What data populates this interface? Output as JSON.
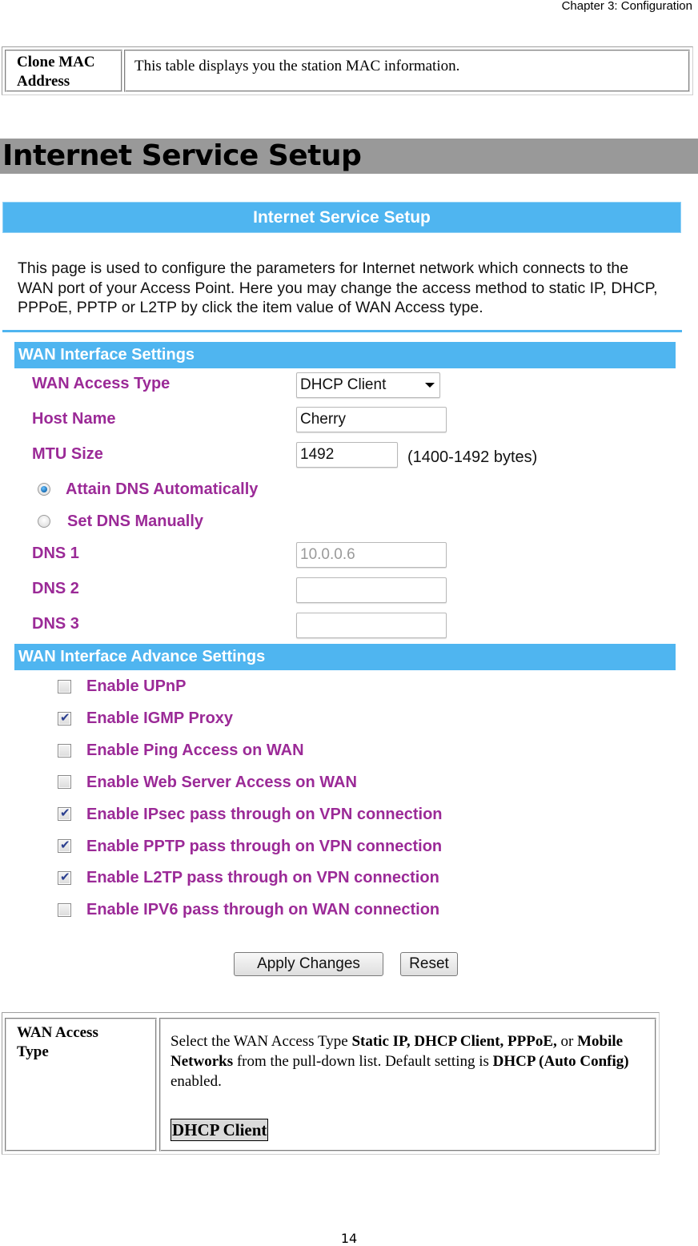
{
  "header": {
    "chapter": "Chapter 3: Configuration"
  },
  "clone_mac_table": {
    "label": "Clone MAC Address",
    "label_line1": "Clone MAC",
    "label_line2": "Address",
    "description": "This table displays you the station MAC information."
  },
  "section": {
    "title": "Internet Service Setup"
  },
  "ui": {
    "title": "Internet Service Setup",
    "intro": "This page is used to configure the parameters for Internet network which connects to the WAN port of your Access Point. Here you may change the access method to static IP, DHCP, PPPoE, PPTP or L2TP by click the item value of WAN Access type.",
    "colors": {
      "bar": "#4fb5f0",
      "label": "#9b2a97"
    },
    "wan_settings": {
      "heading": "WAN Interface Settings",
      "wan_access_type": {
        "label": "WAN Access Type",
        "selected": "DHCP Client"
      },
      "host_name": {
        "label": "Host Name",
        "value": "Cherry"
      },
      "mtu_size": {
        "label": "MTU Size",
        "value": "1492",
        "hint": "(1400-1492 bytes)"
      },
      "dns_mode": [
        {
          "label": "Attain DNS Automatically",
          "checked": true
        },
        {
          "label": "Set DNS Manually",
          "checked": false
        }
      ],
      "dns1": {
        "label": "DNS 1",
        "value": "10.0.0.6"
      },
      "dns2": {
        "label": "DNS 2",
        "value": ""
      },
      "dns3": {
        "label": "DNS 3",
        "value": ""
      }
    },
    "advance_settings": {
      "heading": "WAN Interface Advance Settings",
      "options": [
        {
          "label": "Enable UPnP",
          "checked": false
        },
        {
          "label": "Enable IGMP Proxy",
          "checked": true
        },
        {
          "label": "Enable Ping Access on WAN",
          "checked": false
        },
        {
          "label": "Enable Web Server Access on WAN",
          "checked": false
        },
        {
          "label": "Enable IPsec pass through on VPN connection",
          "checked": true
        },
        {
          "label": "Enable PPTP pass through on VPN connection",
          "checked": true
        },
        {
          "label": "Enable L2TP pass through on VPN connection",
          "checked": true
        },
        {
          "label": "Enable IPV6 pass through on WAN connection",
          "checked": false
        }
      ]
    },
    "buttons": {
      "apply": "Apply Changes",
      "reset": "Reset"
    }
  },
  "wan_access_table": {
    "label_line1": "WAN Access",
    "label_line2": "Type",
    "desc_part1": "Select the WAN Access Type ",
    "desc_bold1": "Static IP, DHCP Client, PPPoE,",
    "desc_part2": " or ",
    "desc_bold2": "Mobile Networks",
    "desc_part3": " from the pull-down list. Default setting is ",
    "desc_bold3": "DHCP (Auto Config)",
    "desc_part4": " enabled.",
    "value": "DHCP Client"
  },
  "footer": {
    "page_number": "14"
  }
}
